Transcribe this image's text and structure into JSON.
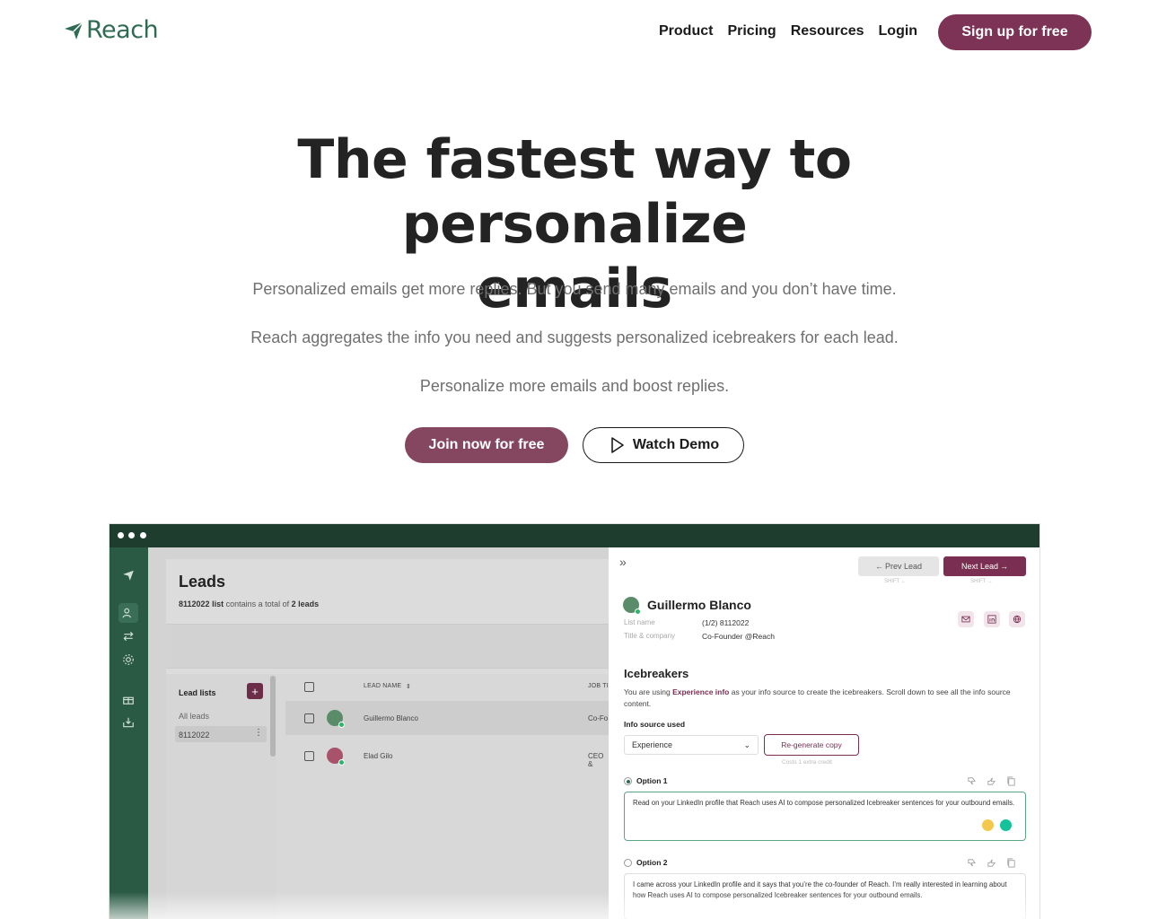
{
  "nav": {
    "brand": "Reach",
    "links": [
      "Product",
      "Pricing",
      "Resources",
      "Login"
    ],
    "cta": "Sign up for free"
  },
  "hero": {
    "title_line1": "The fastest way to personalize",
    "title_line2": "emails",
    "p1": "Personalized emails get more replies. But you send many emails and you don’t have time.",
    "p2": "Reach aggregates the info you need and suggests personalized icebreakers for each lead.",
    "p3": "Personalize more emails and boost replies.",
    "join_btn": "Join now for free",
    "demo_btn": "Watch Demo"
  },
  "app": {
    "leads_title": "Leads",
    "list_id": "8112022",
    "list_word": "list",
    "contains_text": "contains a total of",
    "lead_count": "2 leads",
    "lead_lists_label": "Lead lists",
    "all_leads": "All leads",
    "selected_list": "8112022",
    "columns": {
      "lead_name": "LEAD NAME",
      "job": "JOB TI"
    },
    "rows": [
      {
        "name": "Guillermo Blanco",
        "job": "Co-Fo"
      },
      {
        "name": "Elad Gilo",
        "job": "CEO &"
      }
    ],
    "prev_lead": "Prev Lead",
    "next_lead": "Next Lead",
    "shift_prev": "SHIFT",
    "shift_next": "SHIFT",
    "person_name": "Guillermo Blanco",
    "list_name_label": "List name",
    "list_name_value": "(1/2) 8112022",
    "title_company_label": "Title & company",
    "title_company_value": "Co-Founder @Reach",
    "icebreakers_title": "Icebreakers",
    "ice_text_1": "You are using",
    "ice_text_bold": "Experience info",
    "ice_text_2": "as your info source to create the icebreakers. Scroll down to see all the info source content.",
    "info_source_label": "Info source used",
    "info_source_value": "Experience",
    "regen_btn": "Re-generate copy",
    "costs_note": "Costs 1 extra credit",
    "option1_label": "Option 1",
    "option1_text": "Read on your LinkedIn profile that Reach uses AI to compose personalized Icebreaker sentences for your outbound emails.",
    "option2_label": "Option 2",
    "option2_text": "I came across your LinkedIn profile and it says that you’re the co-founder of Reach. I’m really interested in learning about how Reach uses AI to compose personalized Icebreaker sentences for your outbound emails."
  },
  "colors": {
    "brand_green": "#2e6b52",
    "brand_plum": "#7c3355",
    "rail_green": "#2a5a44",
    "titlebar": "#1e3d2f"
  },
  "icons": [
    "paper-plane-icon",
    "play-icon",
    "users-icon",
    "arrows-icon",
    "settings-icon",
    "gift-icon",
    "inbox-icon",
    "mail-icon",
    "linkedin-icon",
    "globe-icon",
    "thumbs-down-icon",
    "thumbs-up-icon",
    "copy-icon",
    "chevron-down-icon",
    "double-chevron-icon"
  ]
}
